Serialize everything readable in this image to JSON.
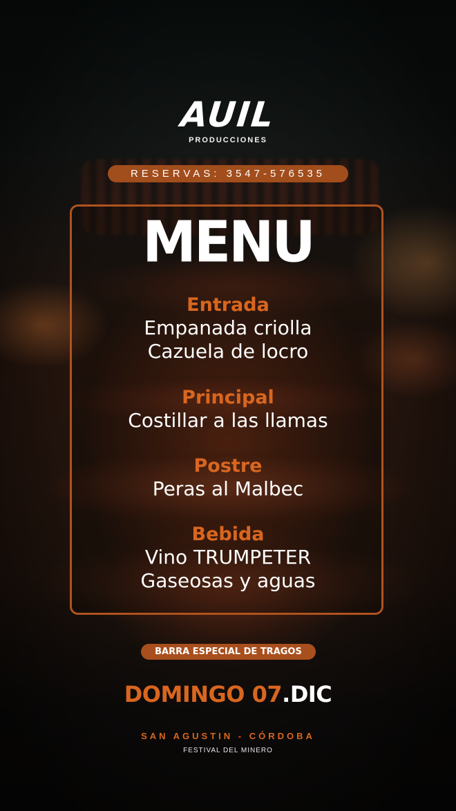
{
  "logo": {
    "brand": "AUIL",
    "subtitle": "PRODUCCIONES"
  },
  "reservas": "RESERVAS: 3547-576535",
  "menu": {
    "title": "MENU",
    "sections": [
      {
        "heading": "Entrada",
        "items": [
          "Empanada criolla",
          "Cazuela de locro"
        ]
      },
      {
        "heading": "Principal",
        "items": [
          "Costillar a las llamas"
        ]
      },
      {
        "heading": "Postre",
        "items": [
          "Peras al Malbec"
        ]
      },
      {
        "heading": "Bebida",
        "items": [
          "Vino TRUMPETER",
          "Gaseosas y aguas"
        ]
      }
    ]
  },
  "barra": "BARRA ESPECIAL DE TRAGOS",
  "fecha": {
    "part1": "DOMINGO 07",
    "part2": ".DIC"
  },
  "lugar": "SAN AGUSTIN - CÓRDOBA",
  "festival": "FESTIVAL DEL MINERO",
  "colors": {
    "accent": "#d9661f",
    "badge": "#a84f1d",
    "frame": "#b0531f"
  }
}
